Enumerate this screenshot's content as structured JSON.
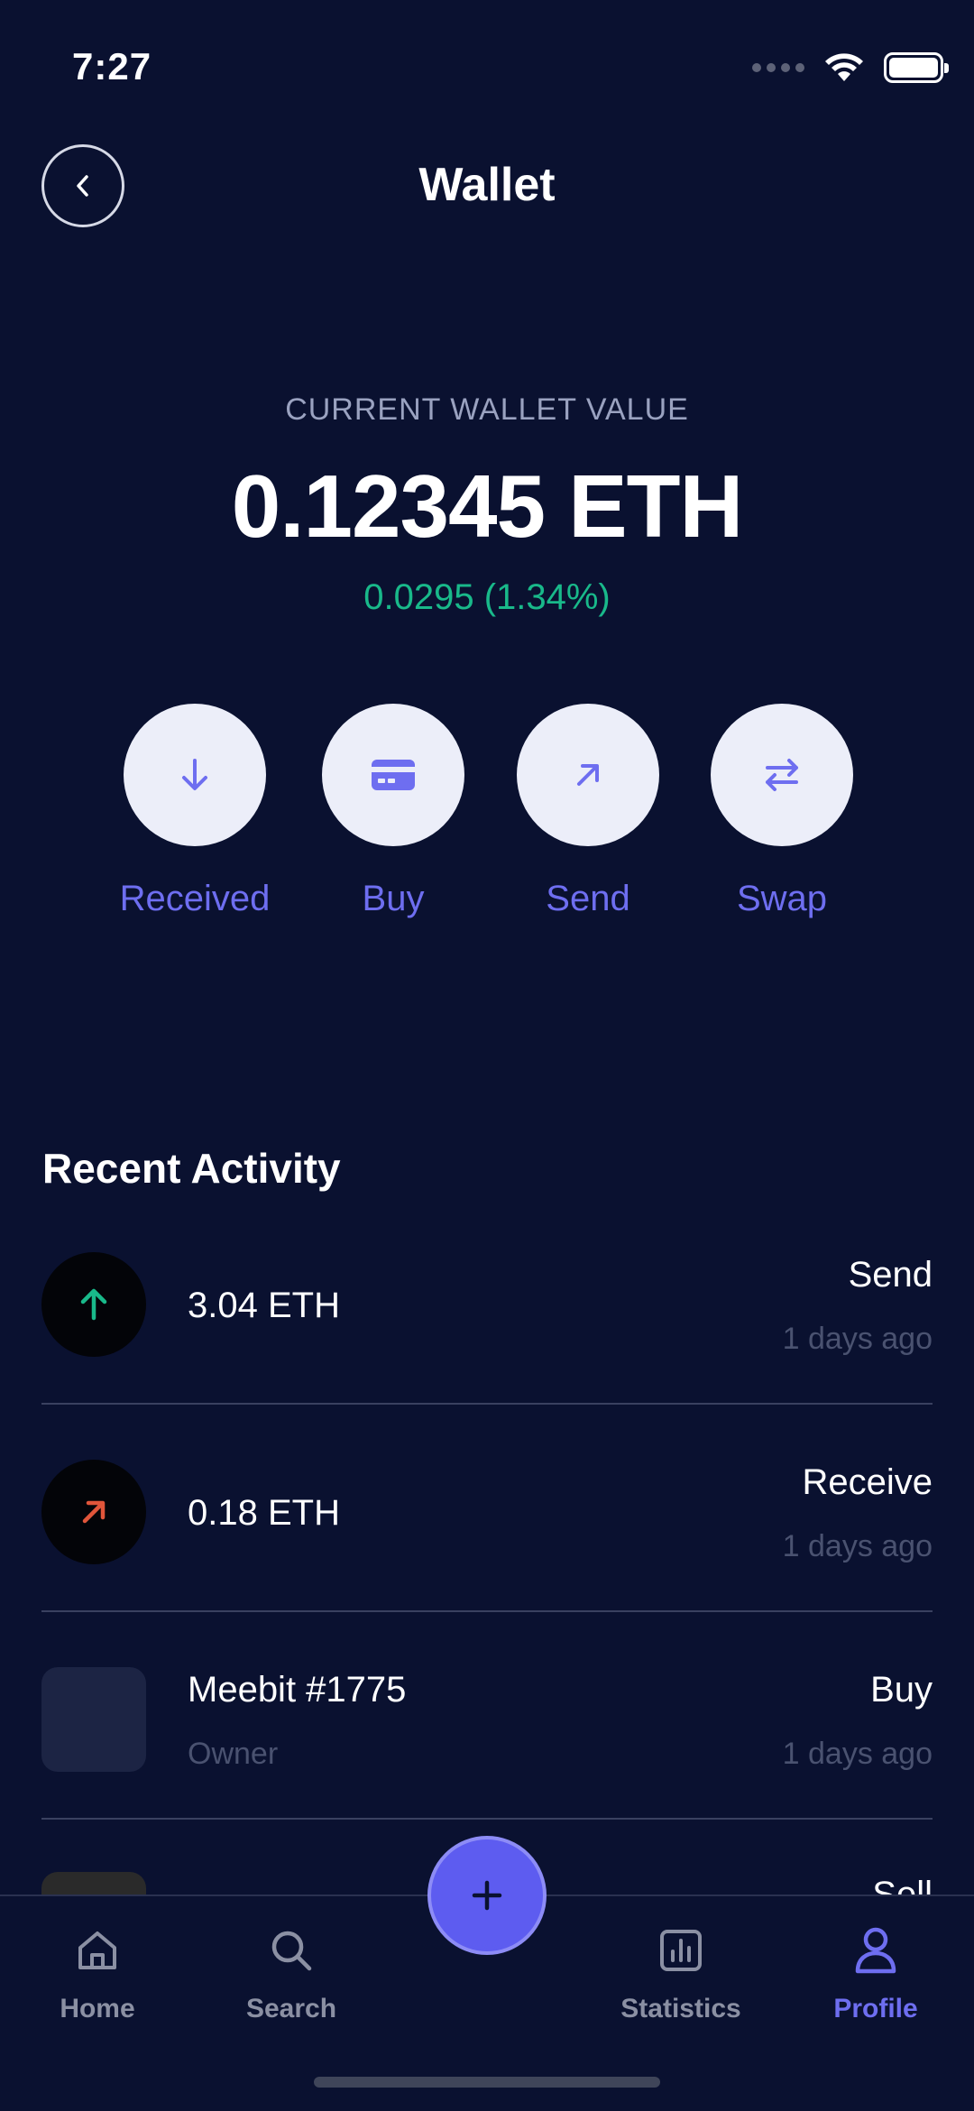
{
  "status_bar": {
    "time": "7:27"
  },
  "header": {
    "title": "Wallet"
  },
  "balance": {
    "label": "CURRENT WALLET VALUE",
    "value": "0.12345 ETH",
    "change": "0.0295 (1.34%)"
  },
  "actions": [
    {
      "label": "Received",
      "icon": "arrow-down-icon"
    },
    {
      "label": "Buy",
      "icon": "credit-card-icon"
    },
    {
      "label": "Send",
      "icon": "arrow-up-right-icon"
    },
    {
      "label": "Swap",
      "icon": "swap-icon"
    }
  ],
  "recent_activity": {
    "title": "Recent Activity",
    "items": [
      {
        "amount": "3.04 ETH",
        "type": "Send",
        "time": "1 days ago",
        "icon": "arrow-up-icon"
      },
      {
        "amount": "0.18 ETH",
        "type": "Receive",
        "time": "1 days ago",
        "icon": "arrow-up-right-icon"
      },
      {
        "amount": "Meebit #1775",
        "sub": "Owner",
        "type": "Buy",
        "time": "1 days ago",
        "icon": "nft-thumbnail"
      },
      {
        "type": "Sell"
      }
    ]
  },
  "bottom_nav": {
    "items": [
      {
        "label": "Home",
        "icon": "home-icon"
      },
      {
        "label": "Search",
        "icon": "search-icon"
      },
      {
        "label": "Statistics",
        "icon": "chart-icon"
      },
      {
        "label": "Profile",
        "icon": "profile-icon",
        "active": true
      }
    ],
    "fab_icon": "plus-icon"
  },
  "colors": {
    "background": "#0a1130",
    "accent": "#6e6ef0",
    "positive": "#19b98a",
    "negative": "#e0553a"
  }
}
